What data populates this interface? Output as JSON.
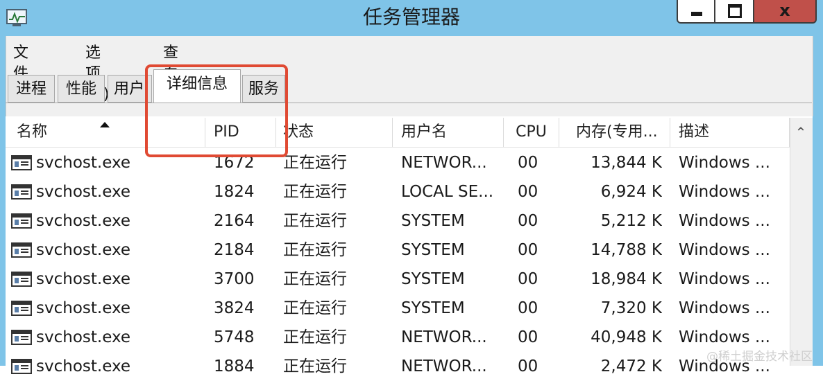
{
  "window": {
    "title": "任务管理器"
  },
  "menu": [
    "文件(F)",
    "选项(O)",
    "查看(V)"
  ],
  "tabs": [
    "进程",
    "性能",
    "用户",
    "详细信息",
    "服务"
  ],
  "active_tab": "详细信息",
  "columns": [
    "名称",
    "PID",
    "状态",
    "用户名",
    "CPU",
    "内存(专用...",
    "描述"
  ],
  "rows": [
    {
      "name": "svchost.exe",
      "pid": "1672",
      "status": "正在运行",
      "user": "NETWOR...",
      "cpu": "00",
      "mem": "13,844 K",
      "desc": "Windows ..."
    },
    {
      "name": "svchost.exe",
      "pid": "1824",
      "status": "正在运行",
      "user": "LOCAL SE...",
      "cpu": "00",
      "mem": "6,924 K",
      "desc": "Windows ..."
    },
    {
      "name": "svchost.exe",
      "pid": "2164",
      "status": "正在运行",
      "user": "SYSTEM",
      "cpu": "00",
      "mem": "5,212 K",
      "desc": "Windows ..."
    },
    {
      "name": "svchost.exe",
      "pid": "2184",
      "status": "正在运行",
      "user": "SYSTEM",
      "cpu": "00",
      "mem": "14,788 K",
      "desc": "Windows ..."
    },
    {
      "name": "svchost.exe",
      "pid": "3700",
      "status": "正在运行",
      "user": "SYSTEM",
      "cpu": "00",
      "mem": "18,984 K",
      "desc": "Windows ..."
    },
    {
      "name": "svchost.exe",
      "pid": "3824",
      "status": "正在运行",
      "user": "SYSTEM",
      "cpu": "00",
      "mem": "7,320 K",
      "desc": "Windows ..."
    },
    {
      "name": "svchost.exe",
      "pid": "5748",
      "status": "正在运行",
      "user": "NETWOR...",
      "cpu": "00",
      "mem": "40,948 K",
      "desc": "Windows ..."
    },
    {
      "name": "svchost.exe",
      "pid": "1884",
      "status": "正在运行",
      "user": "NETWOR...",
      "cpu": "00",
      "mem": "2,472 K",
      "desc": "Windows ..."
    }
  ],
  "watermark": "@稀土掘金技术社区",
  "colors": {
    "titlebar": "#7fc4e8",
    "close_button": "#c0504a",
    "highlight_box": "#e04a33"
  },
  "icons": {
    "app": "task-manager-icon",
    "process": "exe-window-icon",
    "sort": "sort-ascending-icon",
    "scroll_up": "chevron-up-icon"
  }
}
